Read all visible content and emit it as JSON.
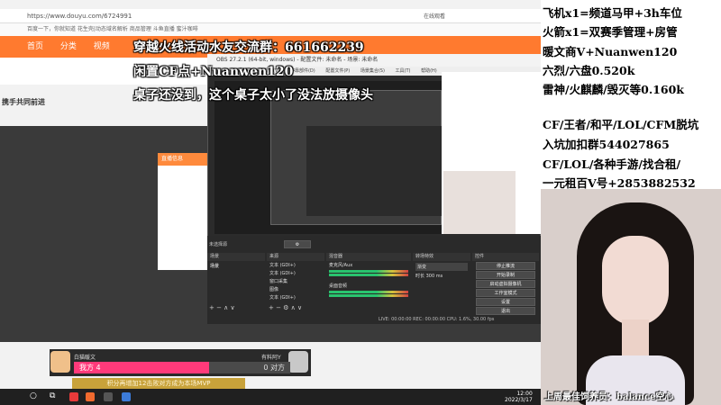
{
  "browser": {
    "url": "https://www.douyu.com/6724991",
    "tab_right": "在线观看",
    "bookmarks": "百度一下，你就知道  花生壳|动态域名解析  商品管理  斗鱼直播  蜜汁咖啡",
    "nav_items": [
      "首页",
      "分类",
      "视频"
    ],
    "page_title": "携手共同前进",
    "dialog_title": "直播信息"
  },
  "obs": {
    "window_title": "OBS 27.2.1 (64-bit, windows) - 配置文件: 未命名 - 场景: 未命名",
    "menu": [
      "文件(F)",
      "编辑(E)",
      "视图(V)",
      "停靠部件(D)",
      "配置文件(P)",
      "场景集合(S)",
      "工具(T)",
      "帮助(H)"
    ],
    "no_source": "未选择源",
    "docks": {
      "scenes": "场景",
      "sources": "来源",
      "mixer": "混音器",
      "transitions": "转场特效",
      "controls": "控件"
    },
    "scene_item": "场景",
    "source_items": [
      "文本 (GDI+)",
      "文本 (GDI+)",
      "窗口采集",
      "图像",
      "文本 (GDI+)"
    ],
    "mixer_tracks": [
      "麦克风/Aux",
      "桌面音频"
    ],
    "transition_value": "渐变",
    "duration_label": "时长",
    "duration_value": "300 ms",
    "controls": [
      "停止推流",
      "开始录制",
      "启动虚拟摄像机",
      "工作室模式",
      "设置",
      "退出"
    ],
    "status": "LIVE: 00:00:00   REC: 00:00:00   CPU: 1.6%, 30.00 fps"
  },
  "overlay_left": [
    "穿越火线活动水友交流群：661662239",
    "闲置CF点+Nuanwen120",
    "桌子还没到，这个桌子太小了没法放摄像头"
  ],
  "overlay_right": [
    "飞机x1=频道马甲+3h车位",
    "火箭x1=双赛季管理+房管",
    "暖文商V+Nuanwen120",
    "六烈/六盘0.520k",
    "雷神/火麒麟/毁灭等0.160k",
    "CF/王者/和平/LOL/CFM脱坑",
    "入坑加扣群544027865",
    "CF/LOL/各种手游/找合租/",
    "一元租百V号+2853882532"
  ],
  "webcam_caption": "上周最佳饲养员：balance空心",
  "pk": {
    "left_name": "白猫暖文",
    "left_score": "我方 4",
    "right_name": "有料阿Y",
    "right_score": "0 对方",
    "banner": "积分再增加12击败对方成为本场MVP"
  },
  "taskbar": {
    "time": "12:00",
    "date": "2022/3/17"
  }
}
